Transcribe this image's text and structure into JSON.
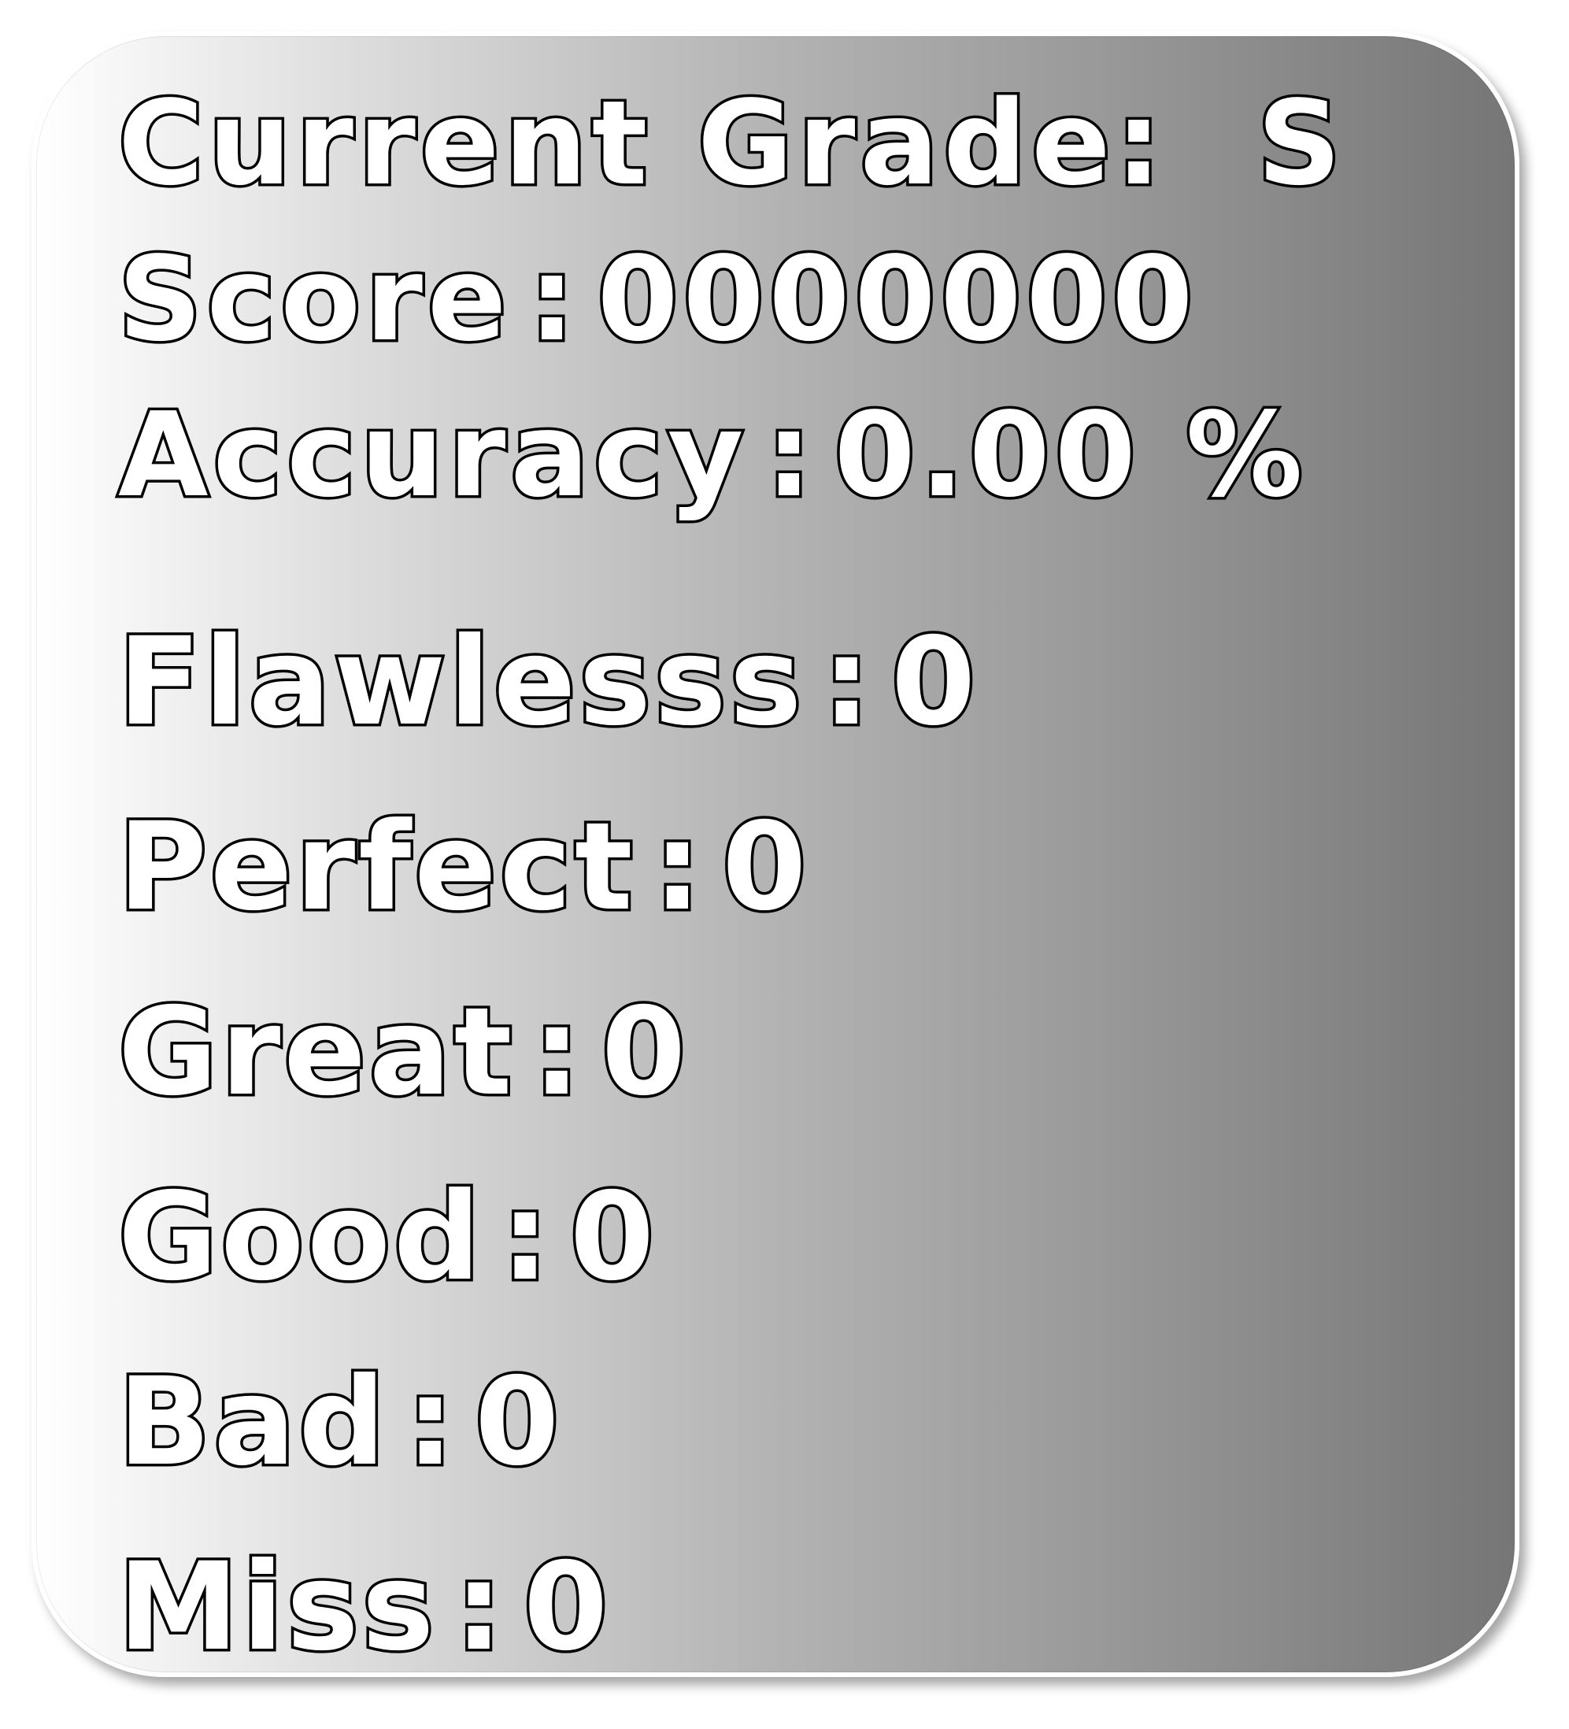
{
  "grade": {
    "label": "Current Grade:",
    "value": "S"
  },
  "score": {
    "label": "Score",
    "value": "0000000"
  },
  "accuracy": {
    "label": "Accuracy",
    "value": "0.00 %"
  },
  "separator": ":",
  "judgments": [
    {
      "label": "Flawlesss",
      "value": "0"
    },
    {
      "label": "Perfect",
      "value": "0"
    },
    {
      "label": "Great",
      "value": "0"
    },
    {
      "label": "Good",
      "value": "0"
    },
    {
      "label": "Bad",
      "value": "0"
    },
    {
      "label": "Miss",
      "value": "0"
    }
  ]
}
